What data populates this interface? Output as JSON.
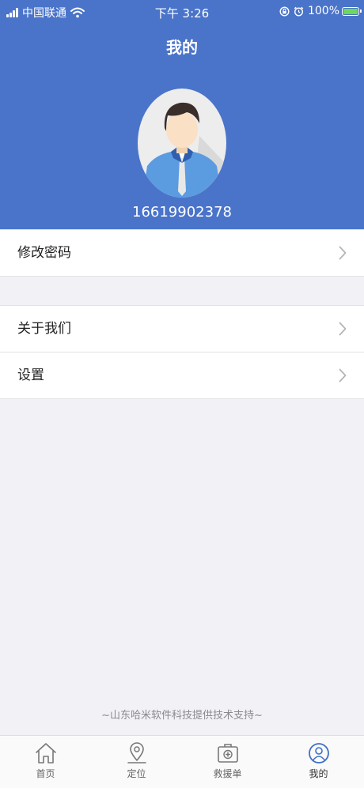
{
  "status_bar": {
    "carrier": "中国联通",
    "time": "下午 3:26",
    "battery": "100%"
  },
  "header": {
    "title": "我的",
    "phone": "16619902378"
  },
  "menu": {
    "change_password": "修改密码",
    "about_us": "关于我们",
    "settings": "设置"
  },
  "footer": {
    "credit": "~山东哈米软件科技提供技术支持~"
  },
  "tabs": [
    {
      "label": "首页",
      "icon": "home-icon"
    },
    {
      "label": "定位",
      "icon": "location-pin-icon"
    },
    {
      "label": "救援单",
      "icon": "first-aid-kit-icon"
    },
    {
      "label": "我的",
      "icon": "profile-icon",
      "active": true
    }
  ],
  "colors": {
    "header_bg": "#4a74c9",
    "page_bg": "#f2f2f6",
    "active_tab": "#3f6fc6"
  }
}
